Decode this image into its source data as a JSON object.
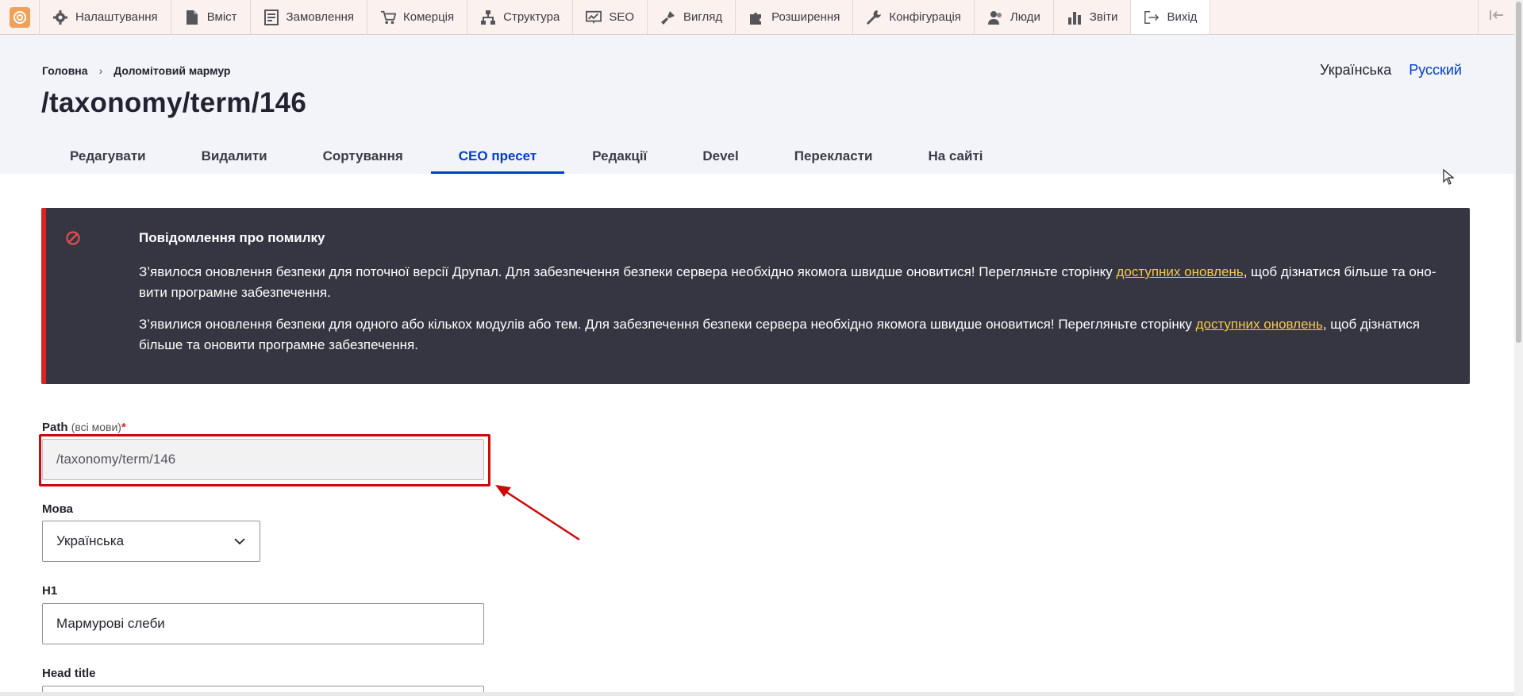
{
  "toolbar": {
    "items": [
      {
        "label": "Налаштування",
        "icon": "gear-icon"
      },
      {
        "label": "Вміст",
        "icon": "document-icon"
      },
      {
        "label": "Замовлення",
        "icon": "order-list-icon"
      },
      {
        "label": "Комерція",
        "icon": "cart-icon"
      },
      {
        "label": "Структура",
        "icon": "structure-icon"
      },
      {
        "label": "SEO",
        "icon": "seo-chart-icon"
      },
      {
        "label": "Вигляд",
        "icon": "brush-icon"
      },
      {
        "label": "Розширення",
        "icon": "puzzle-icon"
      },
      {
        "label": "Конфігурація",
        "icon": "wrench-icon"
      },
      {
        "label": "Люди",
        "icon": "people-icon"
      },
      {
        "label": "Звіти",
        "icon": "bar-chart-icon"
      },
      {
        "label": "Вихід",
        "icon": "logout-icon"
      }
    ]
  },
  "breadcrumb": {
    "home": "Головна",
    "separator": "›",
    "current": "Доломітовий мармур"
  },
  "language_switcher": {
    "current": "Українська",
    "other": "Русский"
  },
  "page_title": "/taxonomy/term/146",
  "tabs": [
    {
      "label": "Редагувати",
      "active": false
    },
    {
      "label": "Видалити",
      "active": false
    },
    {
      "label": "Сортування",
      "active": false
    },
    {
      "label": "СЕО пресет",
      "active": true
    },
    {
      "label": "Редакції",
      "active": false
    },
    {
      "label": "Devel",
      "active": false
    },
    {
      "label": "Перекласти",
      "active": false
    },
    {
      "label": "На сайті",
      "active": false
    }
  ],
  "error_message": {
    "title": "Повідомлення про помилку",
    "p1_before": "З’явилося оновлення безпеки для поточної версії Друпал. Для забезпечення безпеки сервера необхідно якомога швидше оновитися! Перегляньте сторінку ",
    "p1_link": "доступних оновлень",
    "p1_after": ", щоб дізнатися більше та оно-вити програмне забезпечення.",
    "p2_before": "З’явилися оновлення безпеки для одного або кількох модулів або тем. Для забезпечення безпеки сервера необхідно якомога швидше оновитися! Перегляньте сторінку ",
    "p2_link": "доступних оновлень",
    "p2_after": ", щоб дізнатися більше та оновити програмне забезпечення."
  },
  "form": {
    "path": {
      "label": "Path",
      "hint": "(всі мови)",
      "required_mark": "*",
      "value": "/taxonomy/term/146"
    },
    "language": {
      "label": "Мова",
      "value": "Українська"
    },
    "h1": {
      "label": "H1",
      "value": "Мармурові слеби"
    },
    "head_title": {
      "label": "Head title",
      "value": ""
    }
  },
  "colors": {
    "accent": "#003ecc",
    "error": "#dc2323",
    "annotation": "#cc0a0a",
    "message_bg": "#353641",
    "link_in_message": "#f2c94c"
  }
}
